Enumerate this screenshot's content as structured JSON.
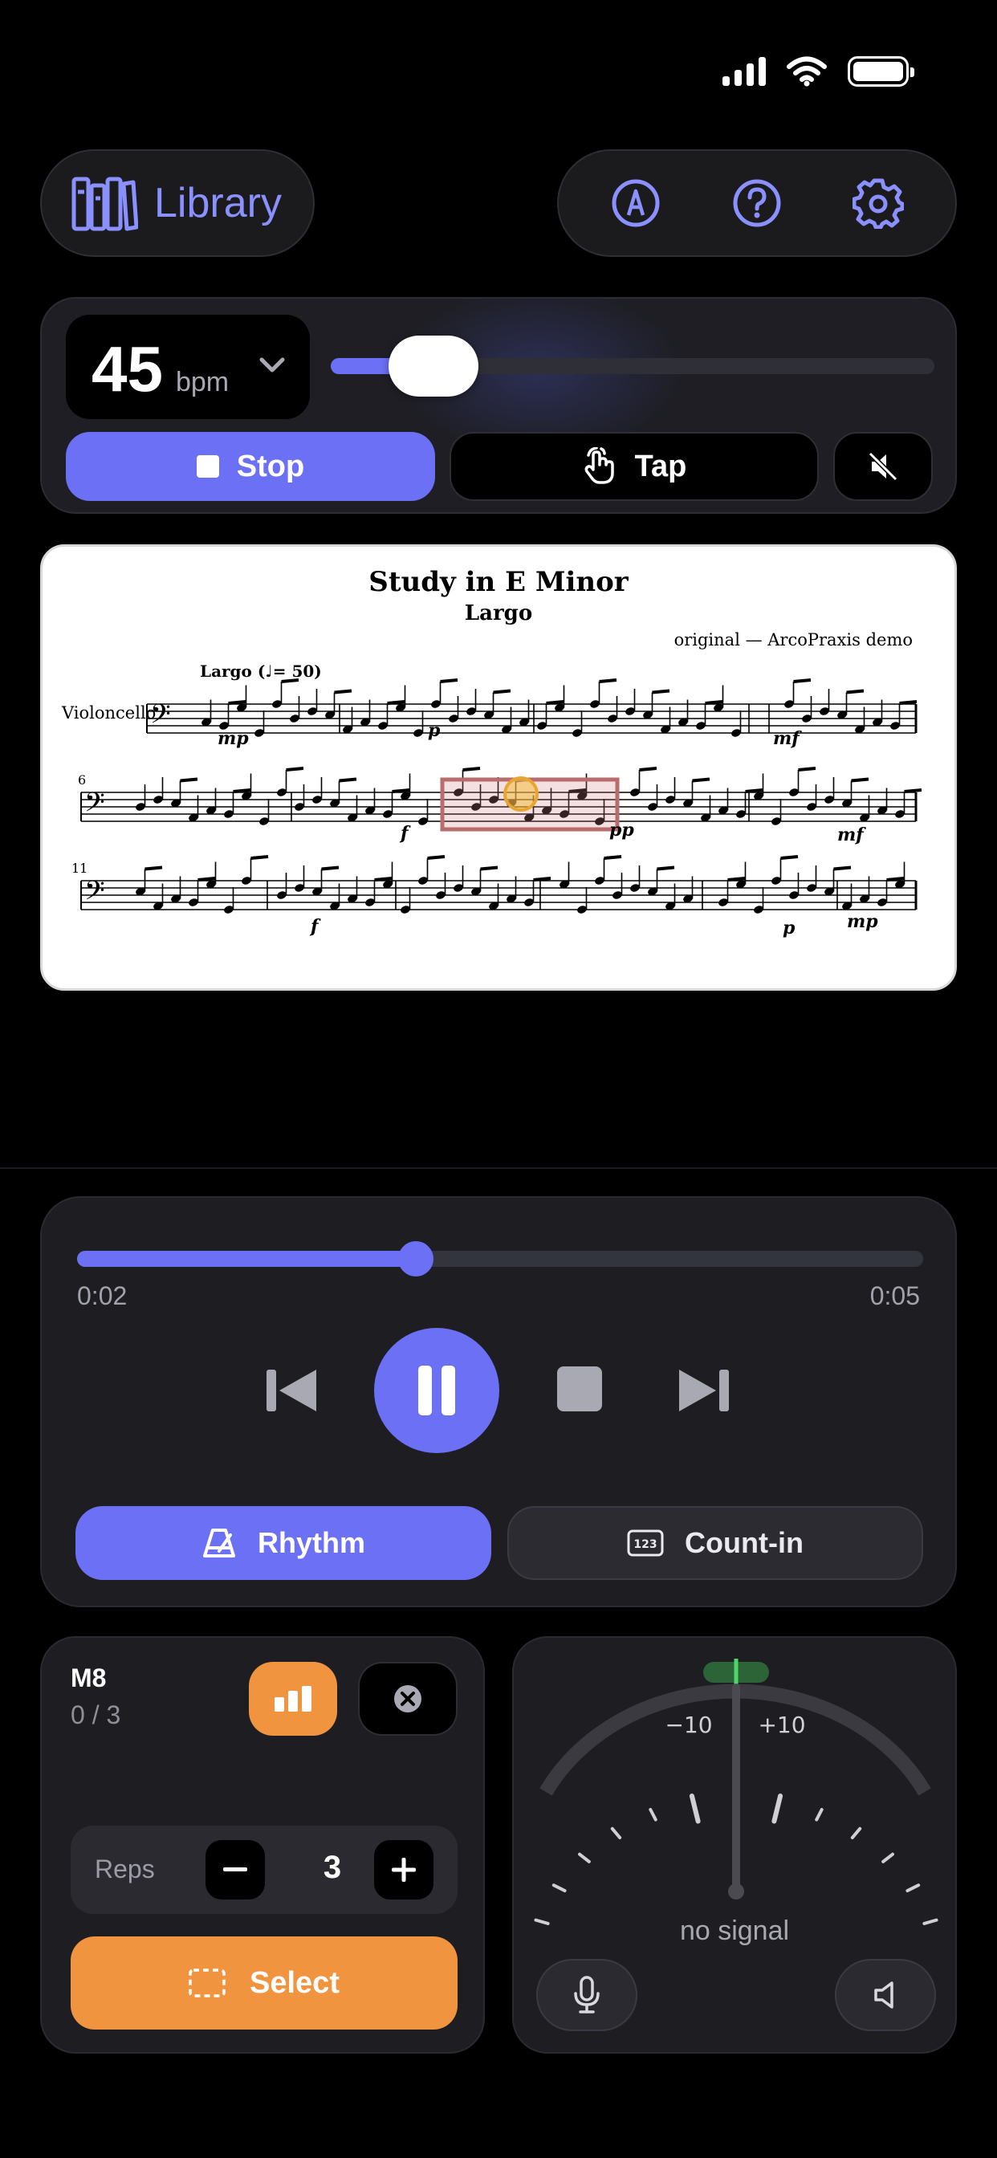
{
  "nav": {
    "library_label": "Library",
    "icons": [
      "library-icon",
      "pencil-icon",
      "help-icon",
      "gear-icon"
    ]
  },
  "metronome": {
    "bpm": "45",
    "bpm_unit": "bpm",
    "tempo_fraction": 0.17,
    "stop_label": "Stop",
    "tap_label": "Tap"
  },
  "score": {
    "title": "Study in E Minor",
    "subtitle": "Largo",
    "credit": "original — ArcoPraxis demo",
    "instrument": "Violoncello",
    "tempo_marking": "Largo (♩= 50)",
    "system_numbers": [
      "6",
      "11"
    ],
    "dynamics": [
      "mp",
      "p",
      "mf",
      "f",
      "pp",
      "mf",
      "f",
      "p",
      "mp"
    ]
  },
  "player": {
    "progress_fraction": 0.4,
    "time_elapsed": "0:02",
    "time_total": "0:05",
    "rhythm_label": "Rhythm",
    "count_in_label": "Count-in"
  },
  "loop": {
    "measure": "M8",
    "count": "0 / 3",
    "reps_label": "Reps",
    "reps_value": "3",
    "select_label": "Select"
  },
  "tuner": {
    "minus_label": "−10",
    "plus_label": "+10",
    "status": "no signal"
  },
  "colors": {
    "accent": "#6b70f5",
    "orange": "#f0943f",
    "tuner_green": "#4fd66a"
  }
}
